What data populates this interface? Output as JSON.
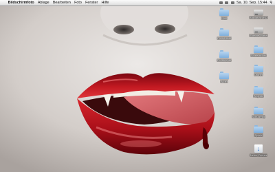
{
  "menubar": {
    "apple_glyph": "",
    "app_name": "Bildschirmfoto",
    "items": [
      "Ablage",
      "Bearbeiten",
      "Foto",
      "Fenster",
      "Hilfe"
    ],
    "clock": "Sa. 10. Sep. 15:44",
    "status_icons": [
      "wifi-icon",
      "volume-icon",
      "sync-icon",
      "spotlight-icon"
    ]
  },
  "desktop": {
    "wallpaper": "red-lips-vampire-fangs",
    "icons": {
      "c1_0": {
        "label": "Mac",
        "type": "folder"
      },
      "c1_1": {
        "label": "Downloads",
        "type": "folder"
      },
      "c1_2": {
        "label": "Dokumente",
        "type": "folder"
      },
      "c1_3": {
        "label": "Bilder",
        "type": "folder"
      },
      "c2_0": {
        "label": "Macintosh HD",
        "type": "drive"
      },
      "c2_1": {
        "label": "Externe Platte",
        "type": "drive"
      },
      "c2_2": {
        "label": "Screenshots",
        "type": "folder"
      },
      "c2_3": {
        "label": "Ordner",
        "type": "folder"
      },
      "c2_4": {
        "label": "Projekte",
        "type": "folder"
      },
      "c2_5": {
        "label": "Schulzeug",
        "type": "folder"
      },
      "c2_6": {
        "label": "Spiele",
        "type": "folder"
      },
      "c2_7": {
        "label": "Neuer Ordner",
        "type": "package"
      }
    }
  },
  "colors": {
    "lip_red": "#b0121c",
    "blood": "#6e0007",
    "skin": "#d9d4d1",
    "folder_blue": "#8cb7df"
  }
}
